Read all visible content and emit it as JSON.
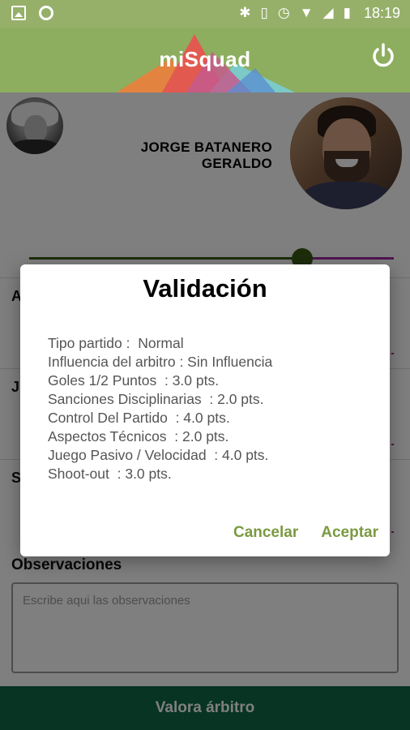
{
  "status_bar": {
    "time": "18:19",
    "icons": [
      "image-icon",
      "circle-icon",
      "bluetooth-icon",
      "vibrate-icon",
      "alarm-icon",
      "wifi-icon",
      "signal-icon",
      "battery-icon"
    ]
  },
  "app_bar": {
    "title": "miSquad",
    "power_icon": "power-icon"
  },
  "profile": {
    "referee_name_line1": "JORGE BATANERO",
    "referee_name_line2": "GERALDO"
  },
  "rating_slider": {
    "value_fraction": 0.75
  },
  "sections": [
    {
      "label": "A"
    },
    {
      "label": "J"
    },
    {
      "label": "S"
    }
  ],
  "observations": {
    "title": "Observaciones",
    "placeholder": "Escribe aqui las observaciones"
  },
  "bottom_button": {
    "label": "Valora árbitro"
  },
  "dialog": {
    "title": "Validación",
    "lines": [
      "Tipo partido :  Normal",
      "Influencia del arbitro : Sin Influencia",
      "Goles 1/2 Puntos  : 3.0 pts.",
      "Sanciones Disciplinarias  : 2.0 pts.",
      "Control Del Partido  : 4.0 pts.",
      "Aspectos Técnicos  : 2.0 pts.",
      "Juego Pasivo / Velocidad  : 4.0 pts.",
      "Shoot-out  : 3.0 pts."
    ],
    "cancel_label": "Cancelar",
    "accept_label": "Aceptar"
  },
  "colors": {
    "status_bar": "#96b06a",
    "app_bar": "#8dae5f",
    "accent": "#7a9a42",
    "bottom_button": "#0f6846",
    "slider_active": "#3b5a14",
    "slider_inactive": "#a02aa5"
  }
}
